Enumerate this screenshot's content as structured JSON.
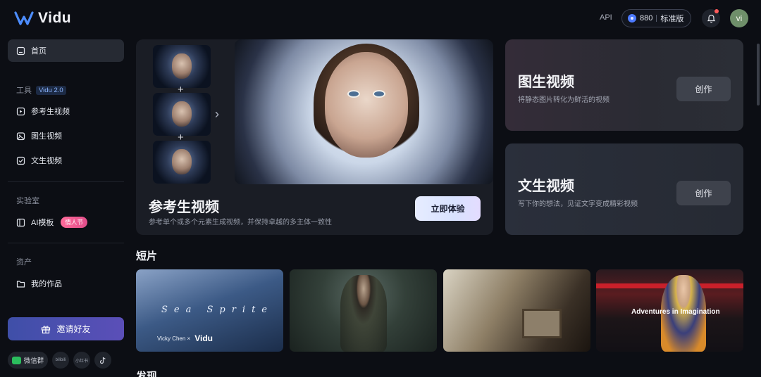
{
  "header": {
    "brand": "Vidu",
    "api_label": "API",
    "credits": "880",
    "plan": "标准版",
    "avatar_initials": "vi"
  },
  "sidebar": {
    "home": "首页",
    "tools_label": "工具",
    "tools_version": "Vidu 2.0",
    "tools": [
      "参考生视频",
      "图生视频",
      "文生视频"
    ],
    "lab_label": "实验室",
    "lab_item": "AI模板",
    "lab_badge": "情人节",
    "assets_label": "资产",
    "assets_item": "我的作品",
    "invite_label": "邀请好友",
    "social": {
      "wechat": "微信群",
      "bilibili": "bilibili",
      "xiaohongshu": "小红书",
      "tiktok": "tiktok-icon"
    }
  },
  "hero": {
    "title": "参考生视频",
    "subtitle": "参考单个或多个元素生成视频，并保持卓越的多主体一致性",
    "cta": "立即体验"
  },
  "cards": [
    {
      "title": "图生视频",
      "subtitle": "将静态图片转化为鲜活的视频",
      "button": "创作"
    },
    {
      "title": "文生视频",
      "subtitle": "写下你的想法，见证文字变成精彩视频",
      "button": "创作"
    }
  ],
  "shorts": {
    "title": "短片",
    "items": [
      {
        "overlay": "Sea Sprite",
        "credit": "Vicky Chen ×",
        "credit_brand": "Vidu"
      },
      {
        "overlay": ""
      },
      {
        "overlay": ""
      },
      {
        "overlay": "Adventures in Imagination"
      }
    ]
  },
  "discover": {
    "title": "发现"
  },
  "colors": {
    "background": "#0c0e14",
    "accent": "#4d7bff",
    "invite_gradient_start": "#3f4fa8",
    "invite_gradient_end": "#5b4fb8",
    "promo_badge": "#e14d8a"
  }
}
